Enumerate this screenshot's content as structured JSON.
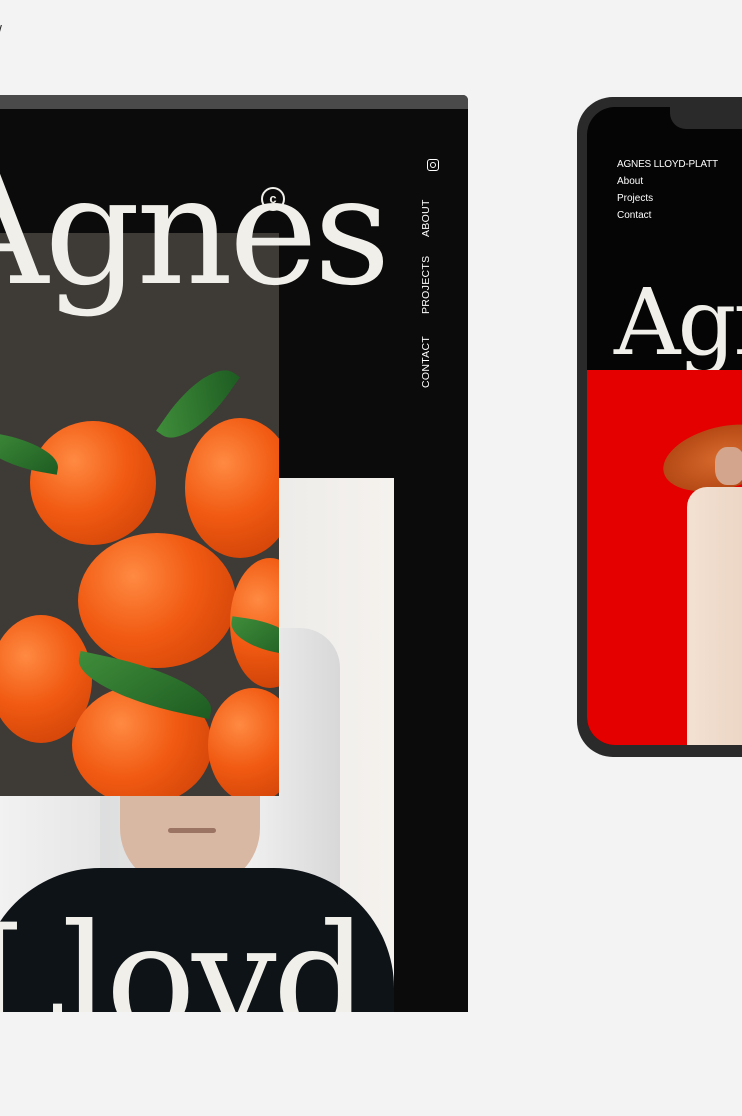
{
  "corner_mark": "/",
  "desktop": {
    "headline_top": "Agnes",
    "headline_bottom": "Lloyd",
    "nav": [
      {
        "label": "ABOUT"
      },
      {
        "label": "PROJECTS"
      },
      {
        "label": "CONTACT"
      }
    ],
    "icons": [
      "instagram-icon",
      "copyright-icon"
    ],
    "copyright_symbol": "c"
  },
  "phone": {
    "menu": {
      "brand": "AGNES LLOYD-PLATT",
      "items": [
        "About",
        "Projects",
        "Contact"
      ]
    },
    "headline": "Agnes"
  },
  "colors": {
    "page_bg": "#f3f3f3",
    "site_bg": "#0b0b0b",
    "accent_red": "#e50000",
    "headline": "#f0efe9"
  }
}
